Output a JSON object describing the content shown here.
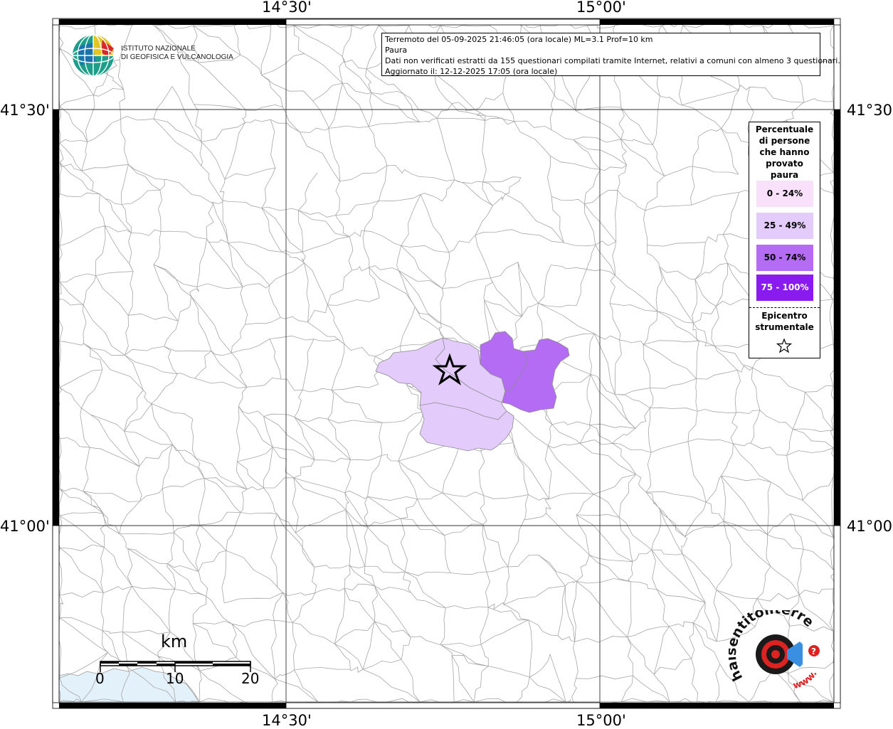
{
  "axes": {
    "top_left_lon": "14°30'",
    "top_right_lon": "15°00'",
    "bottom_left_lon": "14°30'",
    "bottom_right_lon": "15°00'",
    "left_upper_lat": "41°30'",
    "left_lower_lat": "41°00'",
    "right_upper_lat": "41°30'",
    "right_lower_lat": "41°00'"
  },
  "info": {
    "line1": "Terremoto del 05-09-2025 21:46:05 (ora locale) ML=3.1 Prof=10 km",
    "line2": "Paura",
    "line3": "Dati non verificati estratti da 155 questionari compilati tramite Internet, relativi a comuni con almeno 3 questionari.",
    "line4": "Aggiornato il: 12-12-2025 17:05 (ora locale)"
  },
  "logo": {
    "line1": "ISTITUTO NAZIONALE",
    "line2": "DI GEOFISICA E VULCANOLOGIA"
  },
  "legend": {
    "title_lines": [
      "Percentuale",
      "di persone",
      "che hanno",
      "provato",
      "paura"
    ],
    "items": [
      {
        "label": "0 - 24%",
        "color": "#f9e1fb",
        "text_color": "#000000"
      },
      {
        "label": "25 - 49%",
        "color": "#e3ccfb",
        "text_color": "#000000"
      },
      {
        "label": "50 - 74%",
        "color": "#b46cf5",
        "text_color": "#000000"
      },
      {
        "label": "75 - 100%",
        "color": "#8a1bf0",
        "text_color": "#ffffff"
      }
    ],
    "epicenter_lines": [
      "Epicentro",
      "strumentale"
    ]
  },
  "scale": {
    "unit": "km",
    "ticks": [
      "0",
      "10",
      "20"
    ]
  },
  "brand": {
    "text": "haisentitoilterremoto.it",
    "www": "www."
  },
  "colors": {
    "sea": "#e3f1fb",
    "border_gray": "#9a9a9a",
    "class_25_49": "#e3ccfb",
    "class_50_74": "#b46cf5"
  }
}
